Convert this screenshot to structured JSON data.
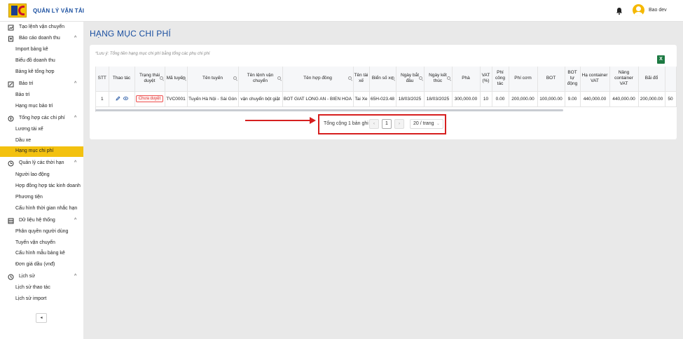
{
  "header": {
    "app_title": "QUẢN LÝ VẬN TẢI",
    "user_name": "Bao dev",
    "icons": {
      "logo": "company-logo",
      "bell": "bell-icon",
      "avatar": "user-avatar-icon"
    }
  },
  "sidebar": {
    "rows": [
      {
        "type": "group",
        "label": "Tạo lệnh vận chuyển",
        "icon": "chart-icon",
        "chevron": ""
      },
      {
        "type": "group",
        "label": "Báo cáo doanh thu",
        "icon": "file-icon",
        "chevron": "^"
      },
      {
        "type": "item",
        "label": "Import bảng kê"
      },
      {
        "type": "item",
        "label": "Biểu đồ doanh thu"
      },
      {
        "type": "item",
        "label": "Bảng kê tổng hợp"
      },
      {
        "type": "group",
        "label": "Bảo trì",
        "icon": "wrench-icon",
        "chevron": "^"
      },
      {
        "type": "item",
        "label": "Bảo trì"
      },
      {
        "type": "item",
        "label": "Hạng mục bảo trì"
      },
      {
        "type": "group",
        "label": "Tổng hợp các chi phí",
        "icon": "money-icon",
        "chevron": "^"
      },
      {
        "type": "item",
        "label": "Lương tài xế"
      },
      {
        "type": "item",
        "label": "Dầu xe"
      },
      {
        "type": "item",
        "label": "Hạng mục chi phí",
        "active": true
      },
      {
        "type": "group",
        "label": "Quản lý các thời hạn",
        "icon": "clock-icon",
        "chevron": "^"
      },
      {
        "type": "item",
        "label": "Người lao động"
      },
      {
        "type": "item",
        "label": "Hợp đồng hợp tác kinh doanh"
      },
      {
        "type": "item",
        "label": "Phương tiện"
      },
      {
        "type": "item",
        "label": "Cấu hình thời gian nhắc hạn"
      },
      {
        "type": "group",
        "label": "Dữ liệu hệ thống",
        "icon": "database-icon",
        "chevron": "^"
      },
      {
        "type": "item",
        "label": "Phân quyền người dùng"
      },
      {
        "type": "item",
        "label": "Tuyến vận chuyển"
      },
      {
        "type": "item",
        "label": "Cấu hình mẫu bảng kê"
      },
      {
        "type": "item",
        "label": "Đơn giá dầu (vnđ)"
      },
      {
        "type": "group",
        "label": "Lịch sử",
        "icon": "history-icon",
        "chevron": "^"
      },
      {
        "type": "item",
        "label": "Lịch sử thao tác"
      },
      {
        "type": "item",
        "label": "Lịch sử import"
      }
    ],
    "collapse_label": "◂"
  },
  "main": {
    "page_title": "HẠNG MỤC CHI PHÍ",
    "note": "*Lưu ý: Tổng tiền hạng mục chi phí bằng tổng các phụ chi phí",
    "export_label": "X",
    "table": {
      "columns": [
        {
          "label": "STT",
          "searchable": false
        },
        {
          "label": "Thao tác",
          "searchable": false
        },
        {
          "label": "Trạng thái duyệt",
          "searchable": true
        },
        {
          "label": "Mã tuyến",
          "searchable": true
        },
        {
          "label": "Tên tuyến",
          "searchable": true
        },
        {
          "label": "Tên lệnh vận chuyển",
          "searchable": true
        },
        {
          "label": "Tên hợp đồng",
          "searchable": true
        },
        {
          "label": "Tên tài xế",
          "searchable": false
        },
        {
          "label": "Biển số xe",
          "searchable": true
        },
        {
          "label": "Ngày bắt đầu",
          "searchable": true
        },
        {
          "label": "Ngày kết thúc",
          "searchable": true
        },
        {
          "label": "Phà",
          "searchable": false
        },
        {
          "label": "VAT (%)",
          "searchable": false
        },
        {
          "label": "Phí công tác",
          "searchable": false
        },
        {
          "label": "Phí cơm",
          "searchable": false
        },
        {
          "label": "BOT",
          "searchable": false
        },
        {
          "label": "BOT tự động",
          "searchable": false
        },
        {
          "label": "Hạ container VAT",
          "searchable": false
        },
        {
          "label": "Nâng container VAT",
          "searchable": false
        },
        {
          "label": "Bãi đổ",
          "searchable": false
        },
        {
          "label": "",
          "searchable": false
        }
      ],
      "rows": [
        {
          "stt": "1",
          "status": "Chưa duyệt",
          "cells": [
            "TVC0001",
            "Tuyến Hà Nội - Sài Gòn",
            "vận chuyển bột giặt",
            "BOT GIAT LONG AN - BIEN HOA",
            "Tai Xe",
            "65H-023.48",
            "18/03/2025",
            "18/03/2025",
            "300,000.00",
            "10",
            "0.00",
            "200,000.00",
            "100,000.00",
            "9.00",
            "440,000.00",
            "440,000.00",
            "200,000.00",
            "50"
          ]
        }
      ]
    },
    "pagination": {
      "total_text": "Tổng cộng 1 bản ghi",
      "prev": "‹",
      "current_page": "1",
      "next": "›",
      "page_size": "20 / trang",
      "page_size_arrow": "⌄"
    }
  },
  "colors": {
    "accent": "#1a4fa0",
    "active": "#f3c10f",
    "highlight": "#d61f1f"
  }
}
